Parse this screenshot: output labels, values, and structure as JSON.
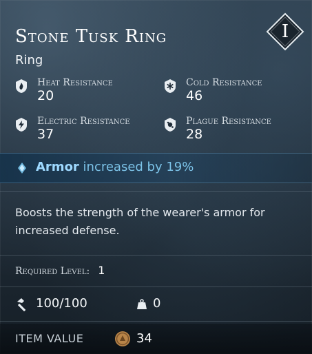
{
  "item": {
    "name": "Stone Tusk Ring",
    "type": "Ring",
    "tier": "I"
  },
  "stats": [
    {
      "label": "Heat Resistance",
      "value": "20",
      "icon": "heat-resistance-icon"
    },
    {
      "label": "Cold Resistance",
      "value": "46",
      "icon": "cold-resistance-icon"
    },
    {
      "label": "Electric Resistance",
      "value": "37",
      "icon": "electric-resistance-icon"
    },
    {
      "label": "Plague Resistance",
      "value": "28",
      "icon": "plague-resistance-icon"
    }
  ],
  "bonus": {
    "keyword": "Armor",
    "text": " increased by 19%",
    "color": "#7cc3e8"
  },
  "description": "Boosts the strength of the wearer's armor for increased defense.",
  "requirements": {
    "label": "Required Level:",
    "level": "1"
  },
  "durability": "100/100",
  "weight": "0",
  "value": {
    "label": "ITEM VALUE",
    "amount": "34"
  },
  "colors": {
    "accent": "#7cc3e8",
    "panel": "#1f2c38"
  }
}
